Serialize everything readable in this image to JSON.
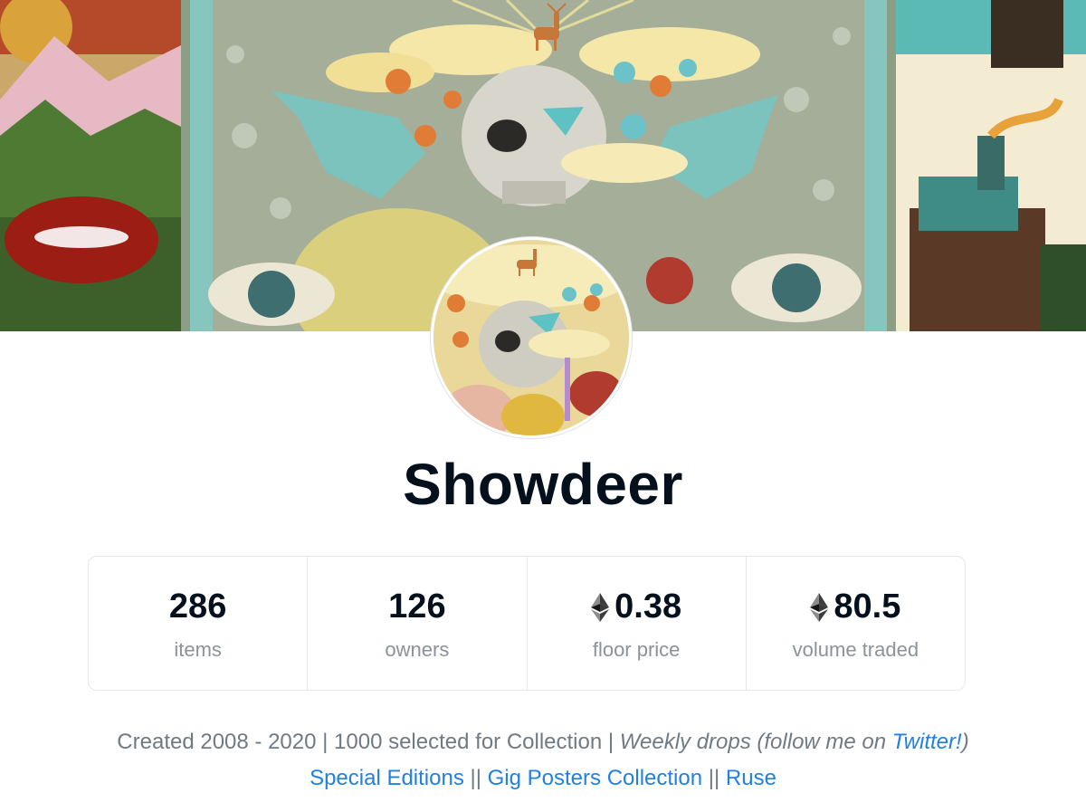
{
  "collection": {
    "name": "Showdeer"
  },
  "stats": [
    {
      "value": "286",
      "label": "items",
      "currency_icon": null
    },
    {
      "value": "126",
      "label": "owners",
      "currency_icon": null
    },
    {
      "value": "0.38",
      "label": "floor price",
      "currency_icon": "ethereum-icon"
    },
    {
      "value": "80.5",
      "label": "volume traded",
      "currency_icon": "ethereum-icon"
    }
  ],
  "description": {
    "line1_plain": "Created 2008 - 2020 | 1000 selected for Collection | ",
    "line1_italic_start": "Weekly drops (follow me on ",
    "line1_link": "Twitter!",
    "line1_italic_end": ")",
    "line2_link1": "Special Editions",
    "line2_sep1": " || ",
    "line2_link2": "Gig Posters Collection",
    "line2_sep2": " || ",
    "line2_link3": "Ruse"
  },
  "colors": {
    "title": "#04111d",
    "muted": "#707a83",
    "link": "#2081e2",
    "border": "#e5e8eb"
  }
}
